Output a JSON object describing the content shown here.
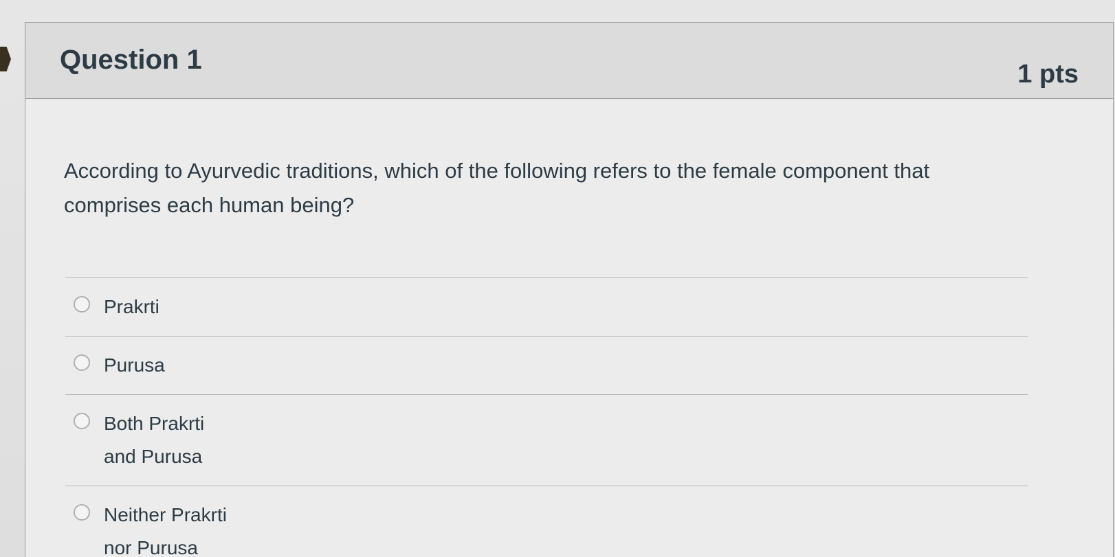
{
  "question": {
    "title": "Question 1",
    "points": "1 pts",
    "text": "According to Ayurvedic traditions, which of the following refers to the female component that comprises each human being?"
  },
  "answers": [
    {
      "label": "Prakrti"
    },
    {
      "label": "Purusa"
    },
    {
      "label": "Both Prakrti and Purusa"
    },
    {
      "label": "Neither Prakrti nor Purusa"
    }
  ],
  "colors": {
    "text": "#2d3b45",
    "header_bg": "#dcdcdc",
    "body_bg": "#ececec"
  }
}
